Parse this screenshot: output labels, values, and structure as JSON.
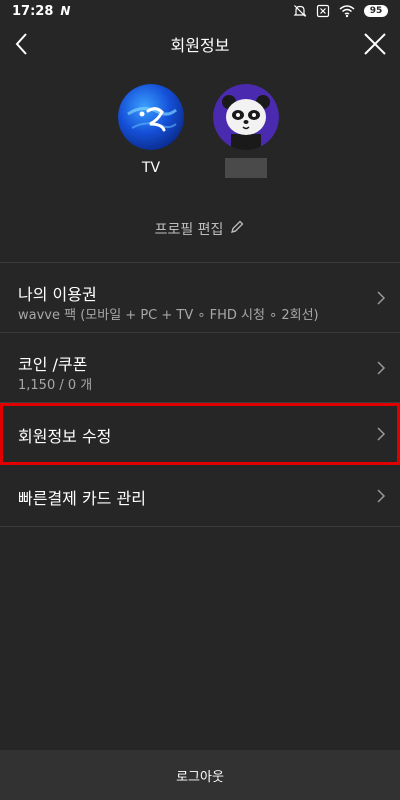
{
  "status_bar": {
    "time": "17:28",
    "notification_logo": "N",
    "battery": "95",
    "icons": [
      "bell-muted-icon",
      "sim-x-icon",
      "wifi-icon",
      "battery-icon"
    ]
  },
  "header": {
    "title": "회원정보",
    "back_icon": "chevron-left-icon",
    "close_icon": "close-icon"
  },
  "profiles": [
    {
      "name": "TV",
      "avatar": "blue-planet-avatar"
    },
    {
      "name": "",
      "avatar": "panda-avatar"
    }
  ],
  "edit_profile": {
    "label": "프로필 편집",
    "icon": "pencil-icon"
  },
  "menu": {
    "items": [
      {
        "label": "나의 이용권",
        "sub": "wavve 팩 (모바일 + PC + TV ∘ FHD 시청 ∘ 2회선)"
      },
      {
        "label": "코인 /쿠폰",
        "sub": "1,150 / 0 개"
      },
      {
        "label": "회원정보 수정",
        "highlighted": true
      },
      {
        "label": "빠른결제 카드 관리"
      }
    ]
  },
  "footer": {
    "logout_label": "로그아웃"
  },
  "colors": {
    "background": "#262626",
    "divider": "#3a3a3a",
    "highlight": "#e00000",
    "footer_bg": "#323232"
  }
}
